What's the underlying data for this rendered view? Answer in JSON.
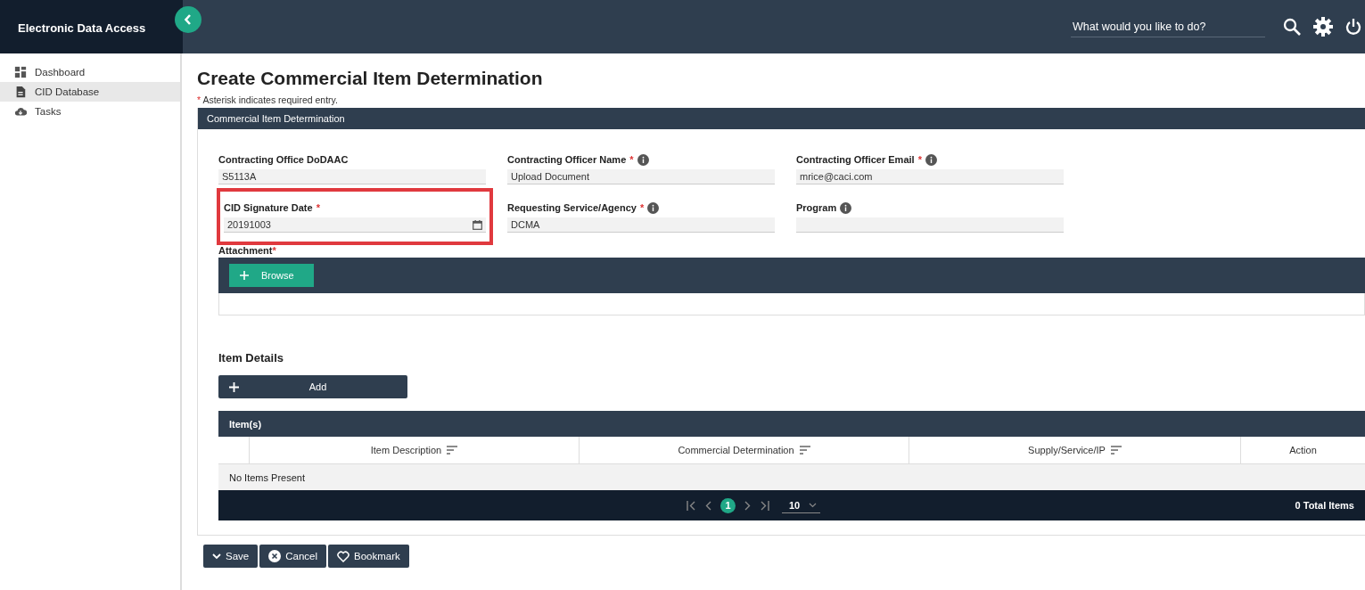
{
  "brand": "Electronic Data Access",
  "search": {
    "placeholder": "What would you like to do?"
  },
  "sidebar": {
    "items": [
      {
        "label": "Dashboard",
        "selected": false
      },
      {
        "label": "CID Database",
        "selected": true
      },
      {
        "label": "Tasks",
        "selected": false
      }
    ]
  },
  "required_mark": "*",
  "page": {
    "title": "Create Commercial Item Determination",
    "required_note": "Asterisk indicates required entry."
  },
  "panel": {
    "title": "Commercial Item Determination",
    "fields": [
      {
        "label": "Contracting Office DoDAAC",
        "required": false,
        "info": false,
        "value": "S5113A",
        "kind": "text",
        "highlighted": false
      },
      {
        "label": "Contracting Officer Name",
        "required": true,
        "info": true,
        "value": "Upload Document",
        "kind": "text",
        "highlighted": false
      },
      {
        "label": "Contracting Officer Email",
        "required": true,
        "info": true,
        "value": "mrice@caci.com",
        "kind": "text",
        "highlighted": false
      },
      {
        "label": "CID Signature Date",
        "required": true,
        "info": false,
        "value": "20191003",
        "kind": "date",
        "highlighted": true
      },
      {
        "label": "Requesting Service/Agency",
        "required": true,
        "info": true,
        "value": "DCMA",
        "kind": "text",
        "highlighted": false
      },
      {
        "label": "Program",
        "required": false,
        "info": true,
        "kind": "text",
        "highlighted": false
      }
    ],
    "attachment": {
      "label": "Attachment",
      "required": true,
      "button": "Browse"
    },
    "items": {
      "heading": "Item Details",
      "add_button": "Add",
      "table": {
        "title": "Item(s)",
        "columns": [
          {
            "label": "Item Description",
            "sortable": true
          },
          {
            "label": "Commercial Determination",
            "sortable": true
          },
          {
            "label": "Supply/Service/IP",
            "sortable": true
          },
          {
            "label": "Action",
            "sortable": false
          }
        ],
        "empty_text": "No Items Present",
        "pager": {
          "pages": [
            {
              "label": "1",
              "selected": true
            }
          ],
          "page_size": "10",
          "total": "0 Total Items"
        }
      }
    }
  },
  "actions": [
    {
      "label": "Save"
    },
    {
      "label": "Cancel"
    },
    {
      "label": "Bookmark"
    }
  ]
}
